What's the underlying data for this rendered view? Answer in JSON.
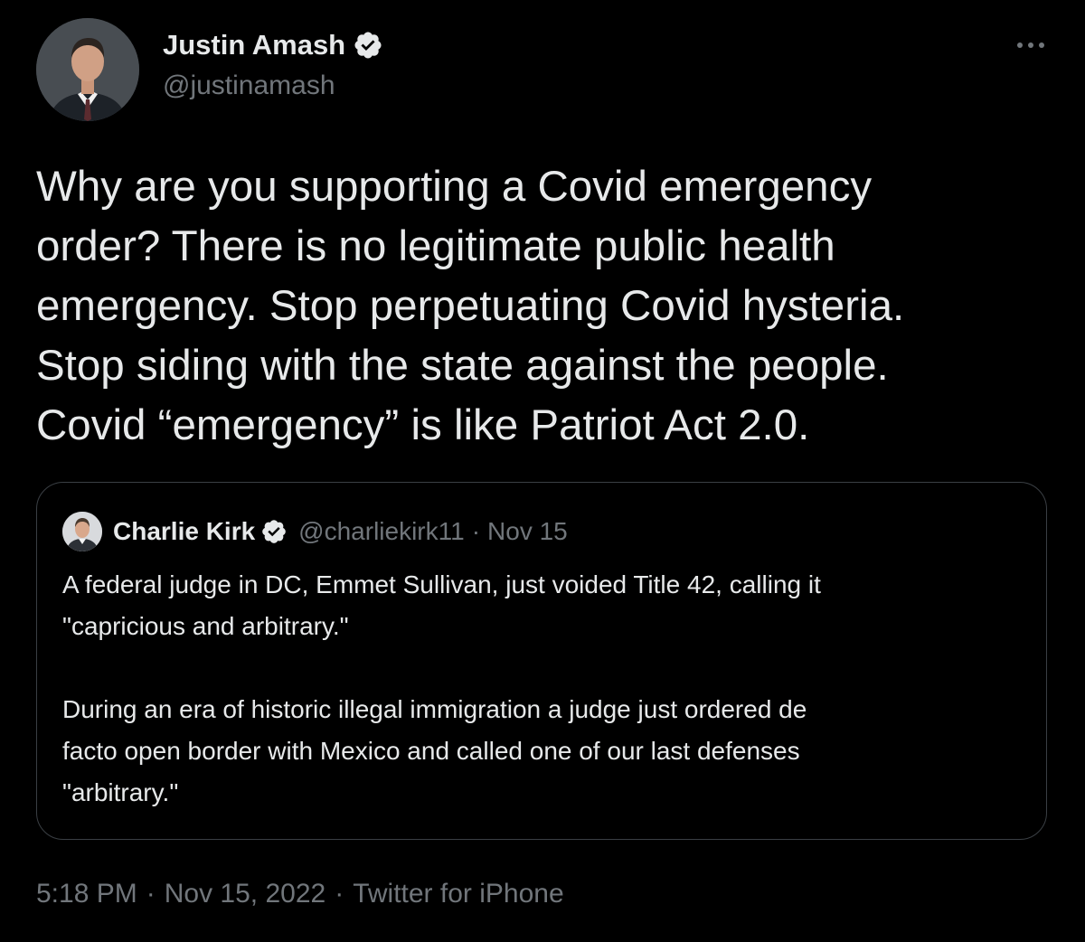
{
  "author": {
    "display_name": "Justin Amash",
    "handle": "@justinamash",
    "verified": true
  },
  "more_icon": "more-horizontal-icon",
  "tweet": {
    "lines": [
      "Why are you supporting a Covid emergency",
      "order? There is no legitimate public health",
      "emergency. Stop perpetuating Covid hysteria.",
      "Stop siding with the state against the people.",
      "Covid “emergency” is like Patriot Act 2.0."
    ]
  },
  "quote": {
    "display_name": "Charlie Kirk",
    "handle": "@charliekirk11",
    "separator": "·",
    "date": "Nov 15",
    "verified": true,
    "lines": [
      "A federal judge in DC, Emmet Sullivan, just voided Title 42, calling it",
      "\"capricious and arbitrary.\"",
      "",
      "During an era of historic illegal immigration a judge just ordered de",
      "facto open border with Mexico and called one of our last defenses",
      "\"arbitrary.\""
    ]
  },
  "footer": {
    "time": "5:18 PM",
    "separator": "·",
    "date": "Nov 15, 2022",
    "source": "Twitter for iPhone"
  },
  "colors": {
    "background": "#000000",
    "text": "#e7e9ea",
    "muted": "#71767b",
    "border": "#3a3f44",
    "verified_badge": "#e7e9ea"
  }
}
